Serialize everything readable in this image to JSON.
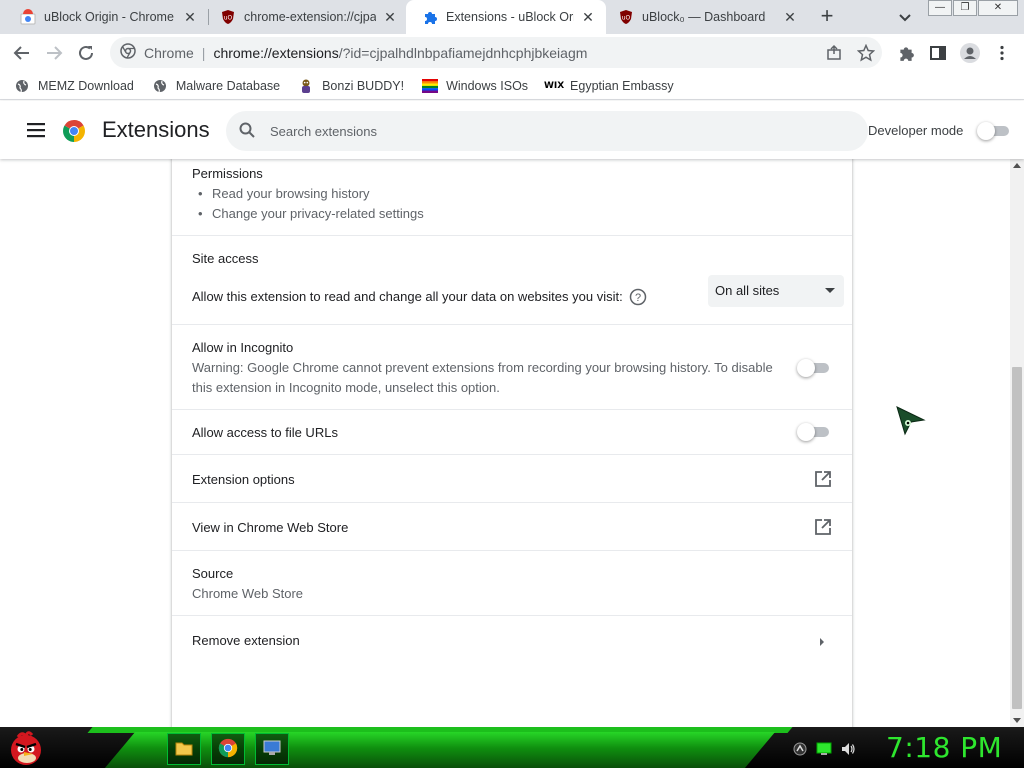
{
  "tabs": [
    {
      "title": "uBlock Origin - Chrome Web Store",
      "favicon": "chrome-web-store-icon",
      "active": false
    },
    {
      "title": "chrome-extension://cjpalhdlnbpafiamejdnhcphjbkeiagm",
      "favicon": "ublock-origin-icon",
      "active": false
    },
    {
      "title": "Extensions - uBlock Origin",
      "favicon": "puzzle-piece-icon",
      "active": true
    },
    {
      "title": "uBlock₀ — Dashboard",
      "favicon": "ublock-origin-icon",
      "active": false
    }
  ],
  "toolbar": {
    "site_label": "Chrome",
    "url_host": "chrome://extensions",
    "url_rest": "/?id=cjpalhdlnbpafiamejdnhcphjbkeiagm"
  },
  "bookmarks": [
    {
      "label": "MEMZ Download",
      "icon": "globe-icon"
    },
    {
      "label": "Malware Database",
      "icon": "globe-icon"
    },
    {
      "label": "Bonzi BUDDY!",
      "icon": "bonzi-icon"
    },
    {
      "label": "Windows ISOs",
      "icon": "rainbow-flag-icon"
    },
    {
      "label": "Egyptian Embassy",
      "icon": "wix-icon"
    }
  ],
  "header": {
    "title": "Extensions",
    "search_placeholder": "Search extensions",
    "developer_mode_label": "Developer mode",
    "developer_mode_on": false
  },
  "details": {
    "permissions_title": "Permissions",
    "permissions": [
      "Read your browsing history",
      "Change your privacy-related settings"
    ],
    "site_access_title": "Site access",
    "site_access_text": "Allow this extension to read and change all your data on websites you visit:",
    "site_access_value": "On all sites",
    "incognito_title": "Allow in Incognito",
    "incognito_warning_line1": "Warning: Google Chrome cannot prevent extensions from recording your browsing history. To disable",
    "incognito_warning_line2": "this extension in Incognito mode, unselect this option.",
    "incognito_on": false,
    "file_urls_title": "Allow access to file URLs",
    "file_urls_on": false,
    "extension_options_label": "Extension options",
    "web_store_label": "View in Chrome Web Store",
    "source_title": "Source",
    "source_value": "Chrome Web Store",
    "remove_label": "Remove extension"
  },
  "taskbar": {
    "clock": "7:18 PM",
    "pinned": [
      "file-explorer-icon",
      "chrome-icon",
      "computer-icon"
    ],
    "accent_color": "#2ee62e"
  }
}
